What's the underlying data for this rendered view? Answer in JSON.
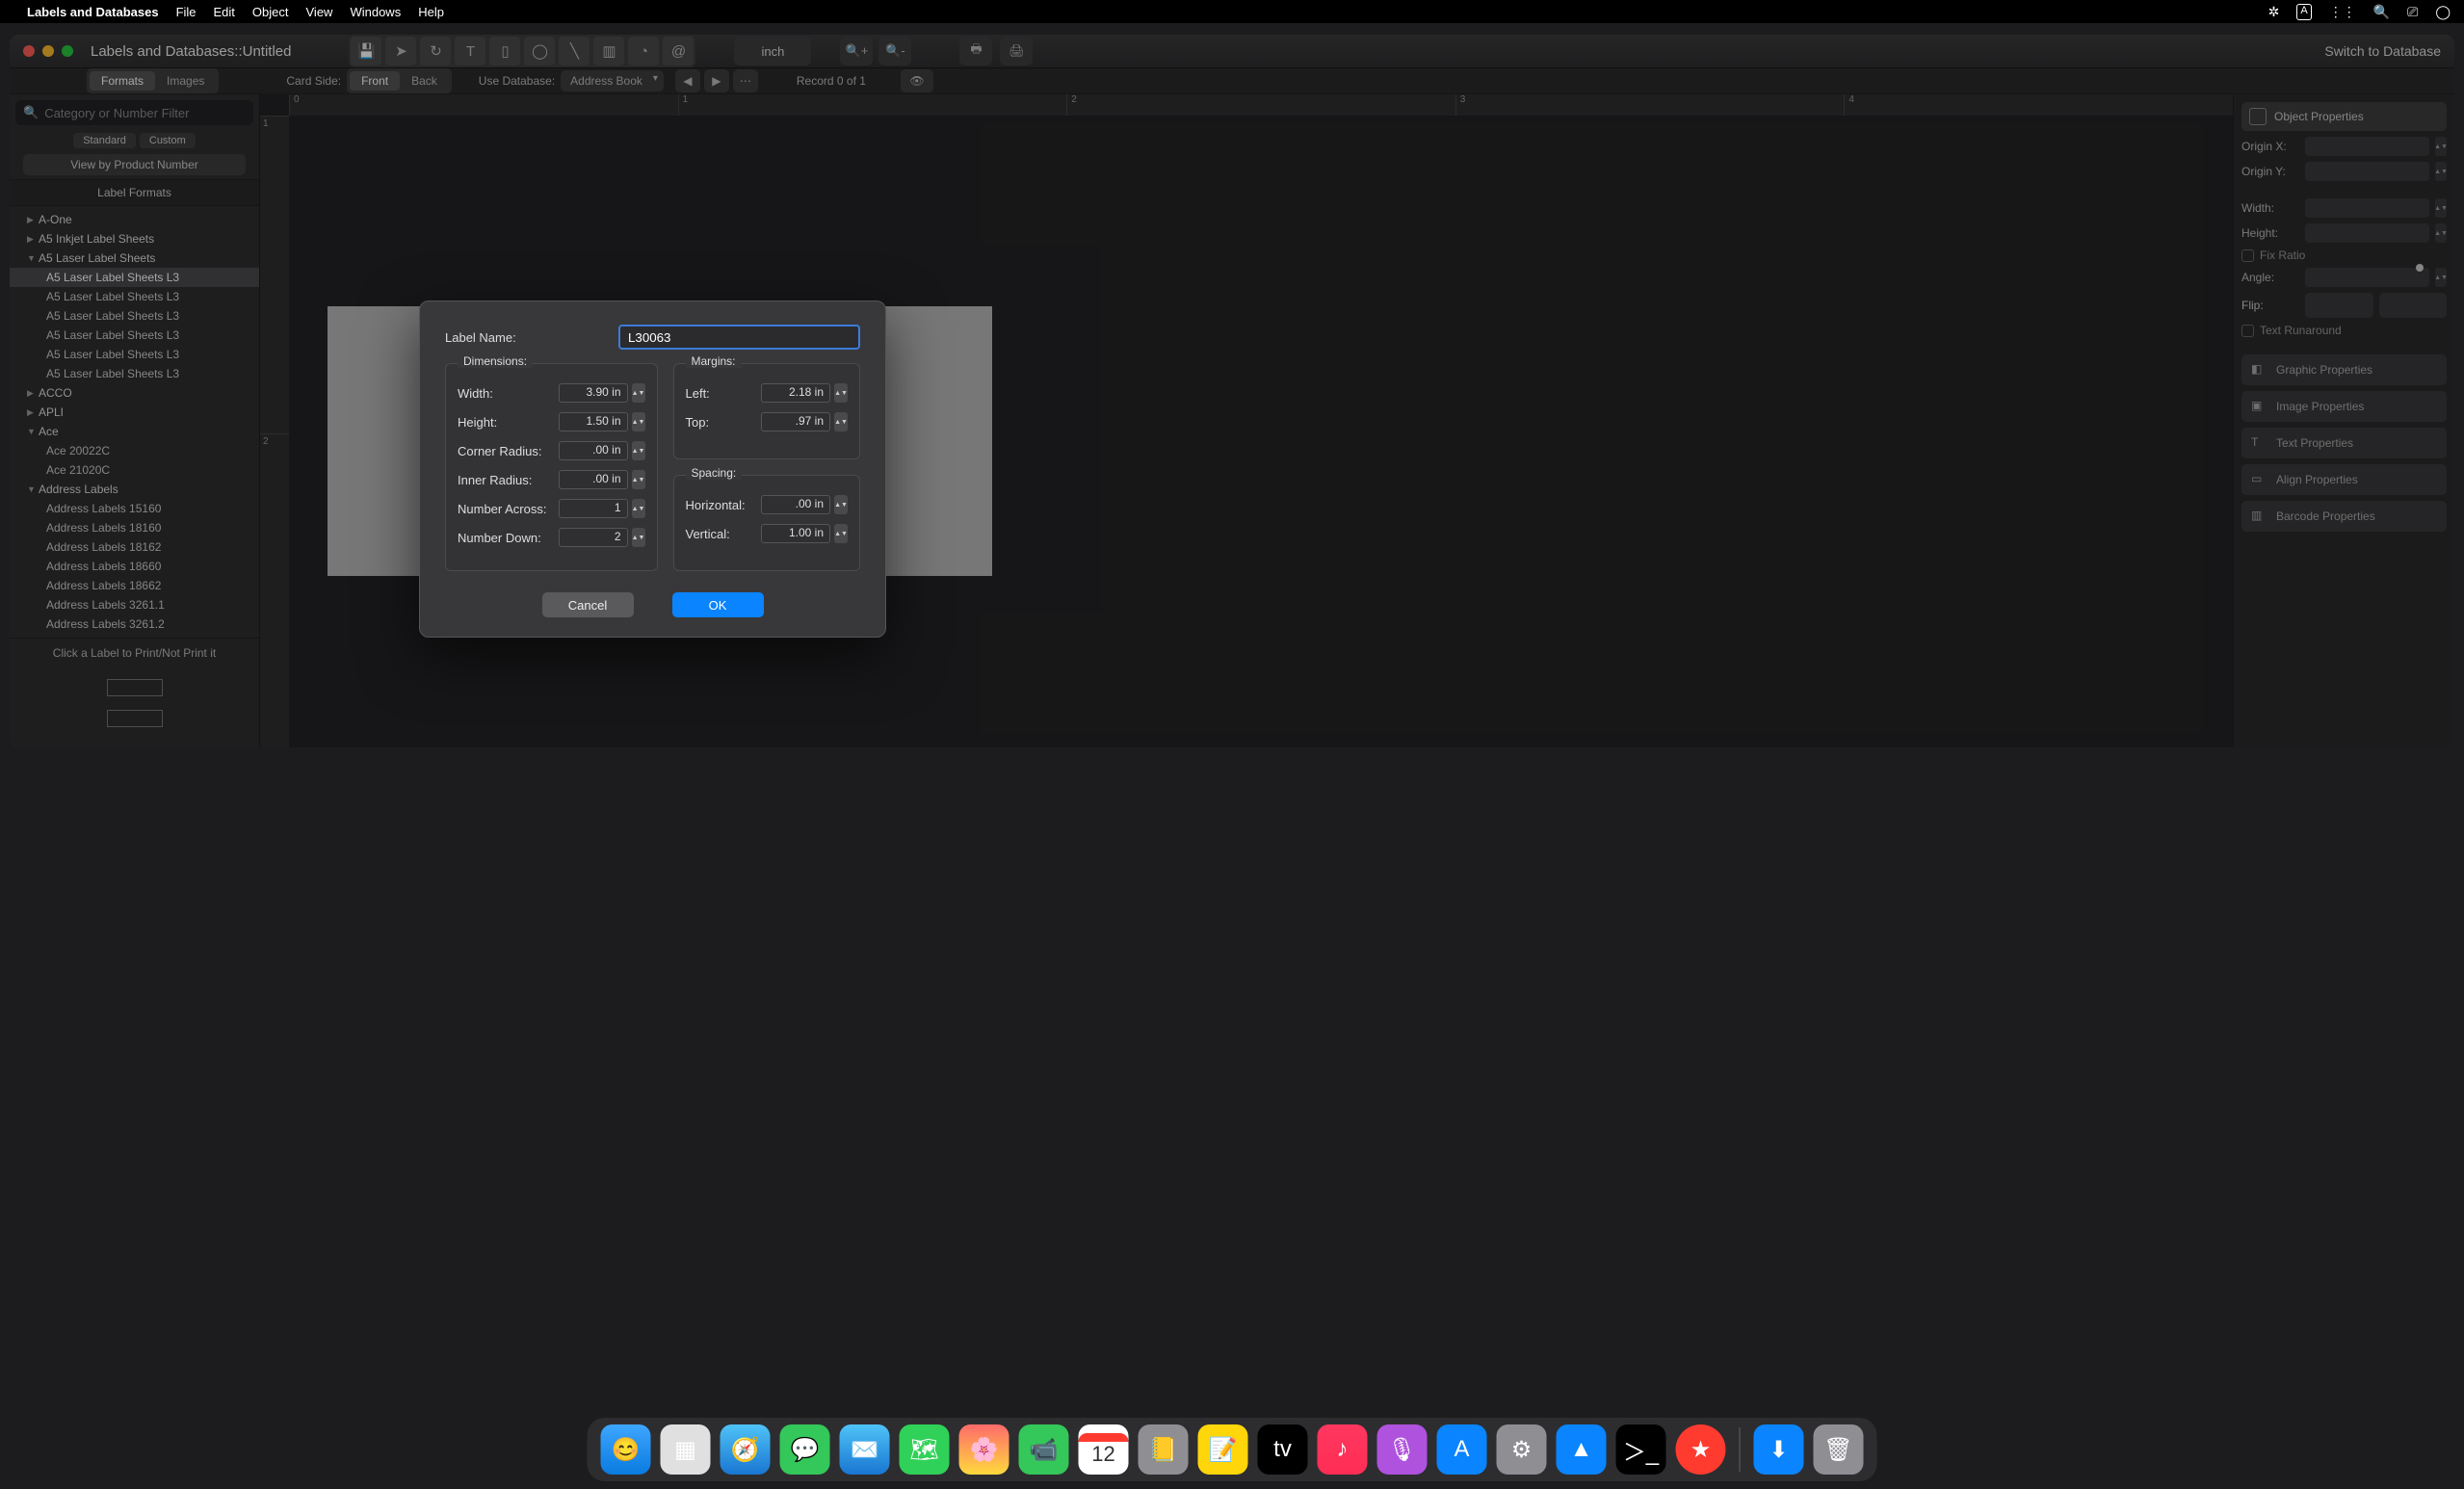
{
  "menubar": {
    "app": "Labels and Databases",
    "items": [
      "File",
      "Edit",
      "Object",
      "View",
      "Windows",
      "Help"
    ]
  },
  "window": {
    "title": "Labels and  Databases::Untitled",
    "toolbar_icons": [
      "save",
      "pointer",
      "rotate",
      "text",
      "column",
      "oval",
      "line",
      "barcode",
      "clock",
      "at"
    ],
    "unit_button": "inch",
    "switch_link": "Switch to Database"
  },
  "toolbar2": {
    "tabs": [
      "Formats",
      "Images"
    ],
    "active_tab": 0,
    "card_side_label": "Card Side:",
    "front": "Front",
    "back": "Back",
    "use_db_label": "Use Database:",
    "use_db_value": "Address Book",
    "record_status": "Record 0 of 1"
  },
  "sidebar": {
    "search_placeholder": "Category or Number Filter",
    "type_tabs": [
      "Standard",
      "Custom"
    ],
    "view_by": "View by Product Number",
    "list_header": "Label Formats",
    "tree": [
      {
        "label": "A-One",
        "lvl": 0,
        "disc": "▶"
      },
      {
        "label": "A5 Inkjet Label Sheets",
        "lvl": 0,
        "disc": "▶"
      },
      {
        "label": "A5 Laser Label Sheets",
        "lvl": 0,
        "disc": "▼"
      },
      {
        "label": "A5 Laser Label Sheets L3",
        "lvl": 1,
        "sel": true
      },
      {
        "label": "A5 Laser Label Sheets L3",
        "lvl": 1
      },
      {
        "label": "A5 Laser Label Sheets L3",
        "lvl": 1
      },
      {
        "label": "A5 Laser Label Sheets L3",
        "lvl": 1
      },
      {
        "label": "A5 Laser Label Sheets L3",
        "lvl": 1
      },
      {
        "label": "A5 Laser Label Sheets L3",
        "lvl": 1
      },
      {
        "label": "ACCO",
        "lvl": 0,
        "disc": "▶"
      },
      {
        "label": "APLI",
        "lvl": 0,
        "disc": "▶"
      },
      {
        "label": "Ace",
        "lvl": 0,
        "disc": "▼"
      },
      {
        "label": "Ace 20022C",
        "lvl": 1
      },
      {
        "label": "Ace 21020C",
        "lvl": 1
      },
      {
        "label": "Address Labels",
        "lvl": 0,
        "disc": "▼"
      },
      {
        "label": "Address Labels 15160",
        "lvl": 1
      },
      {
        "label": "Address Labels 18160",
        "lvl": 1
      },
      {
        "label": "Address Labels 18162",
        "lvl": 1
      },
      {
        "label": "Address Labels 18660",
        "lvl": 1
      },
      {
        "label": "Address Labels 18662",
        "lvl": 1
      },
      {
        "label": "Address Labels 3261.1",
        "lvl": 1
      },
      {
        "label": "Address Labels 3261.2",
        "lvl": 1
      }
    ],
    "click_msg": "Click a Label to Print/Not Print it"
  },
  "ruler": {
    "h": [
      "0",
      "1",
      "2",
      "3",
      "4"
    ],
    "v": [
      "1",
      "2"
    ]
  },
  "inspector": {
    "title": "Object Properties",
    "originx": "Origin X:",
    "originy": "Origin Y:",
    "width": "Width:",
    "height": "Height:",
    "fix_ratio": "Fix Ratio",
    "angle": "Angle:",
    "flip": "Flip:",
    "text_runaround": "Text Runaround",
    "panels": [
      "Graphic Properties",
      "Image Properties",
      "Text Properties",
      "Align Properties",
      "Barcode Properties"
    ]
  },
  "dialog": {
    "label_name_label": "Label Name:",
    "label_name_value": "L30063",
    "dimensions_title": "Dimensions:",
    "margins_title": "Margins:",
    "spacing_title": "Spacing:",
    "width_l": "Width:",
    "width_v": "3.90 in",
    "height_l": "Height:",
    "height_v": "1.50 in",
    "corner_l": "Corner Radius:",
    "corner_v": ".00 in",
    "inner_l": "Inner Radius:",
    "inner_v": ".00 in",
    "nacross_l": "Number Across:",
    "nacross_v": "1",
    "ndown_l": "Number Down:",
    "ndown_v": "2",
    "left_l": "Left:",
    "left_v": "2.18 in",
    "top_l": "Top:",
    "top_v": ".97 in",
    "horiz_l": "Horizontal:",
    "horiz_v": ".00 in",
    "vert_l": "Vertical:",
    "vert_v": "1.00 in",
    "cancel": "Cancel",
    "ok": "OK"
  },
  "dock": {
    "apps": [
      "Finder",
      "Launchpad",
      "Safari",
      "Messages",
      "Mail",
      "Maps",
      "Photos",
      "FaceTime",
      "Calendar",
      "Contacts",
      "Notes",
      "TV",
      "Music",
      "Podcasts",
      "AppStore",
      "Settings",
      "NordVPN",
      "Terminal",
      "LabelsDB"
    ],
    "calendar_day": "12",
    "right": [
      "Downloads",
      "Trash"
    ]
  }
}
